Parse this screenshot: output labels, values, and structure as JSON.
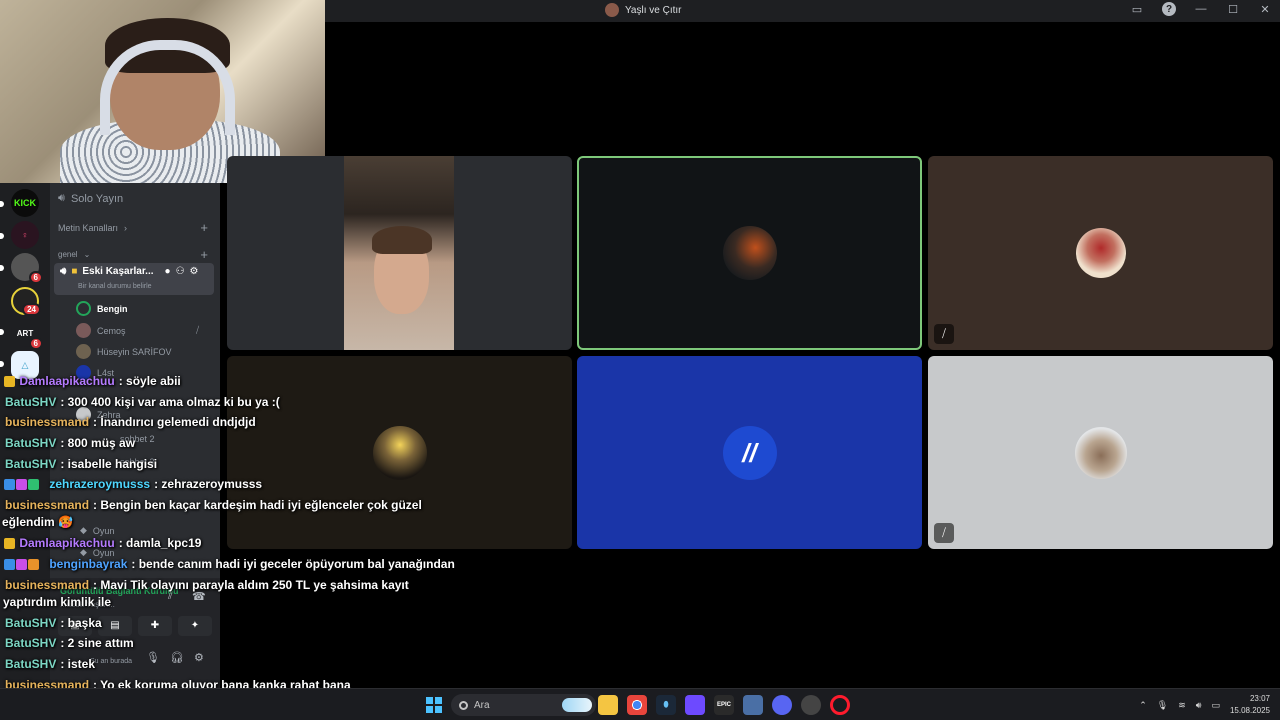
{
  "window": {
    "title": "Yaşlı ve Çıtır"
  },
  "sidebar": {
    "voice_solo": "Solo Yayın",
    "text_channels_header": "Metin Kanalları",
    "general_header": "genel",
    "active_channel": "Eski Kaşarlar...",
    "active_channel_status": "Bir kanal durumu belirle",
    "members": [
      {
        "name": "Bengin"
      },
      {
        "name": "Cemoş"
      },
      {
        "name": "Hüseyin SARİFOV"
      },
      {
        "name": "L4st"
      },
      {
        "name": "Zehra"
      }
    ],
    "other_channels": [
      "sohbet 2",
      "sohbet 3",
      "Oyun",
      "Oyun"
    ],
    "connection_status": "Görüntülü Bağlantı Kuruldu",
    "connection_sub": "...uzda Yaşarl...",
    "user_status": "Şu an burada",
    "servers": [
      {
        "label": "KICK",
        "badge": ""
      },
      {
        "label": "",
        "badge": ""
      },
      {
        "label": "",
        "badge": "6"
      },
      {
        "label": "",
        "badge": "24"
      },
      {
        "label": "ART",
        "badge": "6"
      },
      {
        "label": "",
        "badge": ""
      }
    ]
  },
  "chat": {
    "messages": [
      {
        "user": "Damlaapikachuu",
        "text": ": söyle abii",
        "color": "#b57bff",
        "badges": [
          "crown"
        ]
      },
      {
        "user": "BatuSHV",
        "text": ": 300 400 kişi var ama olmaz ki bu ya :(",
        "color": "#7cd6c4",
        "badges": []
      },
      {
        "user": "businessmand",
        "text": ": İnandırıcı gelemedi dndjdjd",
        "color": "#e6b35c",
        "badges": []
      },
      {
        "user": "BatuSHV",
        "text": ": 800 müş aw",
        "color": "#7cd6c4",
        "badges": []
      },
      {
        "user": "BatuSHV",
        "text": ": isabelle hangisi",
        "color": "#7cd6c4",
        "badges": []
      },
      {
        "user": "zehrazeroymusss",
        "text": ": zehrazeroymusss",
        "color": "#4fd7ff",
        "badges": [
          "blue",
          "gift",
          "green"
        ]
      },
      {
        "user": "businessmand",
        "text": ": Bengin ben kaçar kardeşim hadi iyi eğlenceler çok güzel",
        "color": "#e6b35c",
        "badges": []
      },
      {
        "user": "",
        "text": "eğlendim 🥵",
        "color": "#ffffff",
        "badges": []
      },
      {
        "user": "Damlaapikachuu",
        "text": ": damla_kpc19",
        "color": "#b57bff",
        "badges": [
          "crown"
        ]
      },
      {
        "user": "benginbayrak",
        "text": ": bende canım hadi iyi geceler öpüyorum bal yanağından",
        "color": "#4fa3ff",
        "badges": [
          "blue",
          "gift",
          "orange"
        ]
      },
      {
        "user": "businessmand",
        "text": ": Mavi Tik olayını parayla aldım 250 TL ye şahsima kayıt",
        "color": "#e6b35c",
        "badges": []
      },
      {
        "user": "",
        "text": "yaptırdım kimlik ile",
        "color": "#ffffff",
        "badges": []
      },
      {
        "user": "BatuSHV",
        "text": ": başka",
        "color": "#7cd6c4",
        "badges": []
      },
      {
        "user": "BatuSHV",
        "text": ": 2 sine attım",
        "color": "#7cd6c4",
        "badges": []
      },
      {
        "user": "BatuSHV",
        "text": ": istek",
        "color": "#7cd6c4",
        "badges": []
      },
      {
        "user": "businessmand",
        "text": ": Yo ek koruma oluyor bana kanka rahat bana",
        "color": "#e6b35c",
        "badges": []
      }
    ]
  },
  "taskbar": {
    "search_placeholder": "Ara",
    "time": "23:07",
    "date": "15.08.2025",
    "apps": [
      {
        "name": "file-explorer",
        "label": "",
        "color": "#f4c542"
      },
      {
        "name": "chrome",
        "label": "",
        "color": "#e8453c"
      },
      {
        "name": "steam",
        "label": "",
        "color": "#1b2838"
      },
      {
        "name": "proton",
        "label": "",
        "color": "#6d4aff"
      },
      {
        "name": "epic-games",
        "label": "EPIC",
        "color": "#2a2a2a"
      },
      {
        "name": "app-6",
        "label": "",
        "color": "#4a6fa5"
      },
      {
        "name": "discord",
        "label": "",
        "color": "#5865f2"
      },
      {
        "name": "app-8",
        "label": "",
        "color": "#444"
      },
      {
        "name": "opera",
        "label": "",
        "color": "#ff1b2d"
      }
    ]
  },
  "colors": {
    "tile_green_border": "#7ec87a",
    "tile_blue": "#1a35a8",
    "tile_grey": "#c7c9cb",
    "tile_brown": "#3b2e27"
  }
}
